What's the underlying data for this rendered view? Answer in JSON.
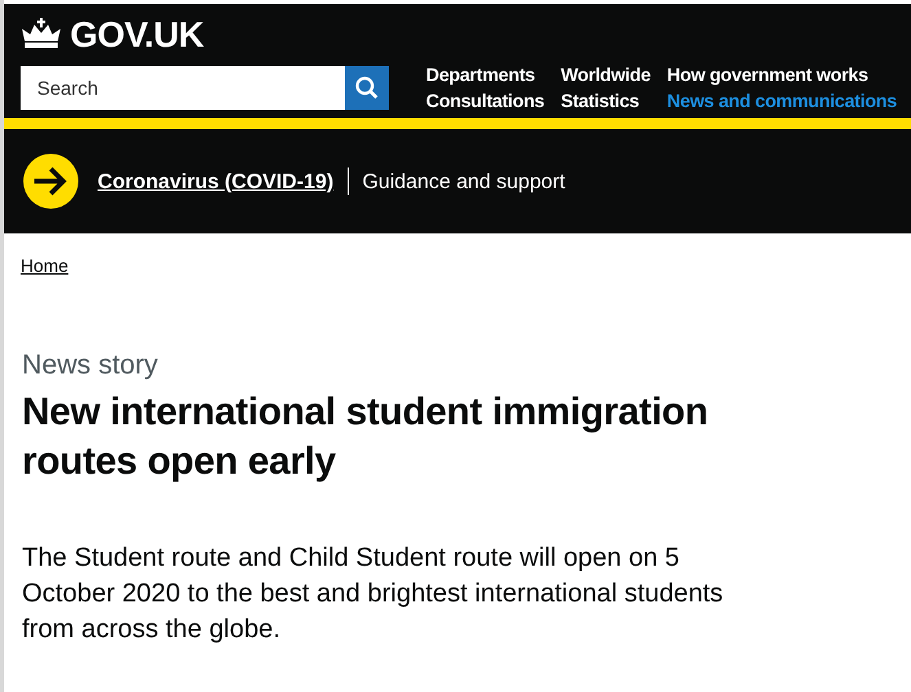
{
  "header": {
    "logo": "GOV.UK",
    "search": {
      "placeholder": "Search"
    },
    "nav": [
      {
        "label": "Departments",
        "selected": false
      },
      {
        "label": "Worldwide",
        "selected": false
      },
      {
        "label": "How government works",
        "selected": false
      },
      {
        "label": "Consultations",
        "selected": false
      },
      {
        "label": "Statistics",
        "selected": false
      },
      {
        "label": "News and communications",
        "selected": true
      }
    ]
  },
  "banner": {
    "link": "Coronavirus (COVID-19)",
    "text": "Guidance and support"
  },
  "breadcrumbs": [
    "Home"
  ],
  "article": {
    "kind_label": "News story",
    "title": "New international student immigration routes open early",
    "summary": "The Student route and Child Student route will open on 5 October 2020 to the best and brightest international students from across the globe."
  }
}
